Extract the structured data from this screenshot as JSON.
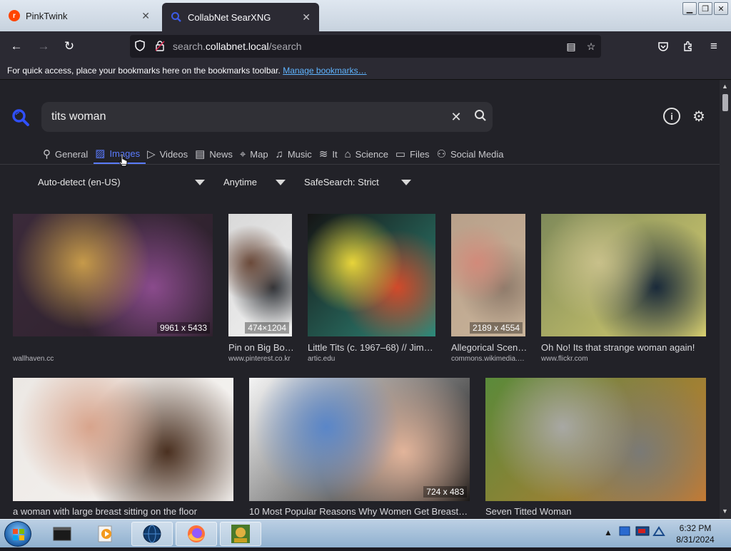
{
  "tabs": [
    {
      "label": "PinkTwink",
      "icon": "reddit-icon"
    },
    {
      "label": "CollabNet SearXNG",
      "icon": "search-icon"
    }
  ],
  "url": {
    "prefix": "search.",
    "domain": "collabnet.local",
    "path": "/search"
  },
  "bookmarks_bar": {
    "text": "For quick access, place your bookmarks here on the bookmarks toolbar.",
    "link": "Manage bookmarks…"
  },
  "search": {
    "query": "tits  woman"
  },
  "categories": [
    {
      "label": "General",
      "icon": "search-icon"
    },
    {
      "label": "Images",
      "icon": "image-icon",
      "active": true
    },
    {
      "label": "Videos",
      "icon": "play-icon"
    },
    {
      "label": "News",
      "icon": "newspaper-icon"
    },
    {
      "label": "Map",
      "icon": "map-pin-icon"
    },
    {
      "label": "Music",
      "icon": "music-note-icon"
    },
    {
      "label": "It",
      "icon": "layers-icon"
    },
    {
      "label": "Science",
      "icon": "graduation-cap-icon"
    },
    {
      "label": "Files",
      "icon": "archive-icon"
    },
    {
      "label": "Social Media",
      "icon": "people-icon"
    }
  ],
  "filters": {
    "language": "Auto-detect (en-US)",
    "time": "Anytime",
    "safesearch": "SafeSearch: Strict"
  },
  "results": [
    {
      "title": "",
      "source": "wallhaven.cc",
      "dims": "9961 x 5433",
      "colors": [
        "#3b2a3a",
        "#c69a4a",
        "#8a4b8c",
        "#2b1f2a"
      ]
    },
    {
      "title": "Pin on Big Bo…",
      "source": "www.pinterest.co.kr",
      "dims": "474×1204",
      "colors": [
        "#d9d9d9",
        "#6b4a3a",
        "#2f3237",
        "#f0f0f0"
      ]
    },
    {
      "title": "Little Tits (c. 1967–68) // Jim…",
      "source": "artic.edu",
      "dims": "",
      "colors": [
        "#151515",
        "#e7d43a",
        "#d24a2a",
        "#2f8a7a"
      ]
    },
    {
      "title": "Allegorical Scen…",
      "source": "commons.wikimedia.…",
      "dims": "2189 x 4554",
      "colors": [
        "#b8a08a",
        "#d28a7a",
        "#8e7a6a",
        "#c9b49a"
      ]
    },
    {
      "title": "Oh No! Its that strange woman again!",
      "source": "www.flickr.com",
      "dims": "",
      "colors": [
        "#7f8a5a",
        "#c8c08a",
        "#1a2a3a",
        "#d9d070"
      ]
    },
    {
      "title": "a woman with large breast sitting on the floor",
      "source": "",
      "dims": "",
      "colors": [
        "#ece8e4",
        "#d8a48c",
        "#4a3020",
        "#f6f4f2"
      ]
    },
    {
      "title": "10 Most Popular Reasons Why Women Get Breast…",
      "source": "",
      "dims": "724 x 483",
      "colors": [
        "#f4f4f4",
        "#5a86c8",
        "#e2b49a",
        "#111111"
      ]
    },
    {
      "title": "Seven Titted Woman",
      "source": "",
      "dims": "",
      "colors": [
        "#5a8a3a",
        "#a8a8a4",
        "#7a7a76",
        "#c87a30"
      ]
    }
  ],
  "clock": {
    "time": "6:32 PM",
    "date": "8/31/2024"
  }
}
